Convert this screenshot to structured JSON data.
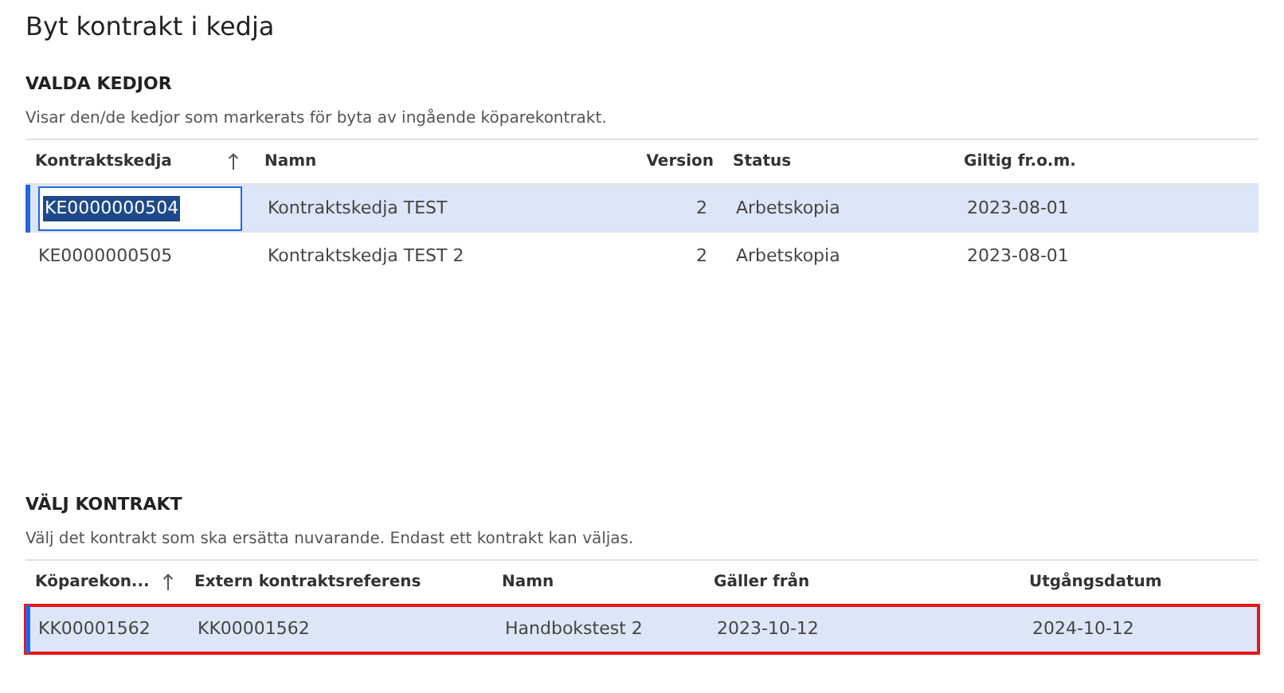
{
  "title": "Byt kontrakt i kedja",
  "sections": [
    {
      "heading": "VALDA KEDJOR",
      "description": "Visar den/de kedjor som markerats för byta av ingående köparekontrakt.",
      "columns": [
        {
          "label": "Kontraktskedja",
          "sorted": true
        },
        {
          "label": "Namn",
          "sorted": false
        },
        {
          "label": "Version",
          "sorted": false
        },
        {
          "label": "Status",
          "sorted": false
        },
        {
          "label": "Giltig fr.o.m.",
          "sorted": false
        }
      ],
      "rows": [
        {
          "selected": true,
          "outlined": false,
          "cells": [
            "KE0000000504",
            "Kontraktskedja TEST",
            "2",
            "Arbetskopia",
            "2023-08-01"
          ]
        },
        {
          "selected": false,
          "outlined": false,
          "cells": [
            "KE0000000505",
            "Kontraktskedja TEST 2",
            "2",
            "Arbetskopia",
            "2023-08-01"
          ]
        }
      ]
    },
    {
      "heading": "VÄLJ KONTRAKT",
      "description": "Välj det kontrakt som ska ersätta nuvarande. Endast ett kontrakt kan väljas.",
      "columns": [
        {
          "label": "Köparekon...",
          "sorted": true
        },
        {
          "label": "Extern kontraktsreferens",
          "sorted": false
        },
        {
          "label": "Namn",
          "sorted": false
        },
        {
          "label": "Gäller från",
          "sorted": false
        },
        {
          "label": "Utgångsdatum",
          "sorted": false
        }
      ],
      "rows": [
        {
          "selected": true,
          "outlined": true,
          "cells": [
            "KK00001562",
            "KK00001562",
            "Handbokstest 2",
            "2023-10-12",
            "2024-10-12"
          ]
        }
      ]
    }
  ]
}
